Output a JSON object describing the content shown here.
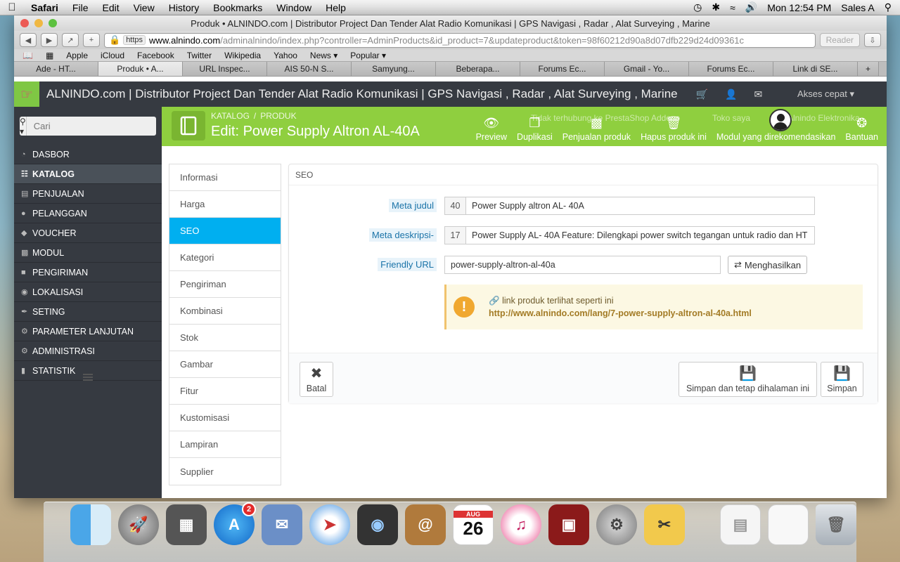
{
  "menubar": {
    "apple": "",
    "items": [
      "Safari",
      "File",
      "Edit",
      "View",
      "History",
      "Bookmarks",
      "Window",
      "Help"
    ],
    "clock": "Mon 12:54 PM",
    "user": "Sales A"
  },
  "window": {
    "title": "Produk • ALNINDO.com | Distributor Project Dan Tender Alat Radio Komunikasi | GPS Navigasi , Radar , Alat Surveying , Marine",
    "url_scheme": "https",
    "url_domain": "www.alnindo.com",
    "url_path": "/adminalnindo/index.php?controller=AdminProducts&id_product=7&updateproduct&token=98f60212d90a8d07dfb229d24d09361c",
    "reader": "Reader",
    "bookmarks": [
      "Apple",
      "iCloud",
      "Facebook",
      "Twitter",
      "Wikipedia",
      "Yahoo",
      "News ▾",
      "Popular ▾"
    ],
    "tabs": [
      "Ade - HT...",
      "Produk • A...",
      "URL Inspec...",
      "AIS 50-N S...",
      "Samyung...",
      "Beberapa...",
      "Forums Ec...",
      "Gmail - Yo...",
      "Forums Ec...",
      "Link di SE..."
    ]
  },
  "app": {
    "header_title": "ALNINDO.com | Distributor Project Dan Tender Alat Radio Komunikasi | GPS Navigasi , Radar , Alat Surveying , Marine",
    "quick_access": "Akses cepat ▾",
    "search_placeholder": "Cari",
    "ghost_notice": "Tidak terhubung ke PrestaShop Addons",
    "ghost_store": "Toko saya",
    "ghost_user": "Alnindo Elektronika",
    "nav": [
      {
        "label": "DASBOR",
        "icon": "dashboard-icon"
      },
      {
        "label": "KATALOG",
        "icon": "book-icon"
      },
      {
        "label": "PENJUALAN",
        "icon": "credit-card-icon"
      },
      {
        "label": "PELANGGAN",
        "icon": "users-icon"
      },
      {
        "label": "VOUCHER",
        "icon": "tag-icon"
      },
      {
        "label": "MODUL",
        "icon": "puzzle-icon"
      },
      {
        "label": "PENGIRIMAN",
        "icon": "truck-icon"
      },
      {
        "label": "LOKALISASI",
        "icon": "globe-icon"
      },
      {
        "label": "SETING",
        "icon": "wrench-icon"
      },
      {
        "label": "PARAMETER LANJUTAN",
        "icon": "cogs-icon"
      },
      {
        "label": "ADMINISTRASI",
        "icon": "cog-icon"
      },
      {
        "label": "STATISTIK",
        "icon": "bar-chart-icon"
      }
    ]
  },
  "toolbar": {
    "breadcrumb": [
      "KATALOG",
      "PRODUK"
    ],
    "page_title": "Edit: Power Supply Altron AL-40A",
    "actions": [
      "Preview",
      "Duplikasi",
      "Penjualan produk",
      "Hapus produk ini",
      "Modul yang direkomendasikan",
      "Bantuan"
    ]
  },
  "product_tabs": [
    "Informasi",
    "Harga",
    "SEO",
    "Kategori",
    "Pengiriman",
    "Kombinasi",
    "Stok",
    "Gambar",
    "Fitur",
    "Kustomisasi",
    "Lampiran",
    "Supplier"
  ],
  "seo": {
    "heading": "SEO",
    "meta_title_label": "Meta judul",
    "meta_title_count": "40",
    "meta_title_value": "Power Supply  altron  AL- 40A",
    "meta_desc_label": "Meta deskripsi-",
    "meta_desc_count": "17",
    "meta_desc_value": "Power Supply AL- 40A  Feature:  Dilengkapi power switch tegangan untuk radio dan HT",
    "friendly_url_label": "Friendly URL",
    "friendly_url_value": "power-supply-altron-al-40a",
    "generate_button": "Menghasilkan",
    "alert_text": "link produk terlihat seperti ini",
    "alert_link": "http://www.alnindo.com/lang/7-power-supply-altron-al-40a.html"
  },
  "footer": {
    "cancel": "Batal",
    "save_stay": "Simpan dan tetap dihalaman ini",
    "save": "Simpan"
  },
  "dock": {
    "calendar_month": "AUG",
    "calendar_day": "26",
    "appstore_badge": "2"
  }
}
